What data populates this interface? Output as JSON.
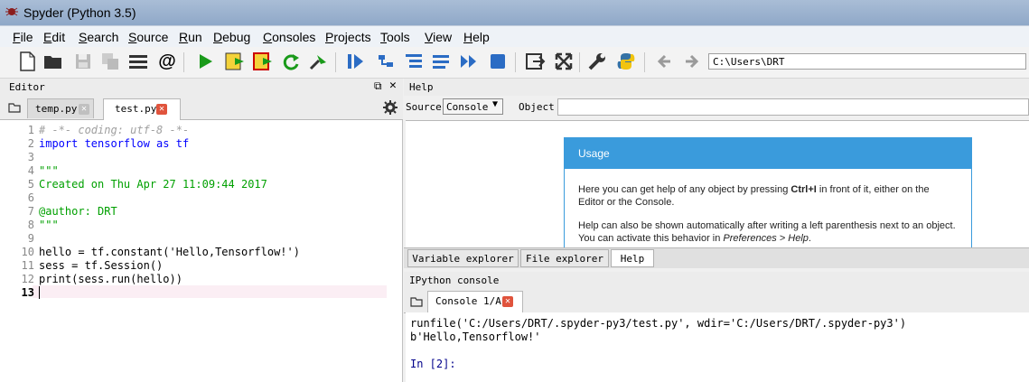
{
  "window": {
    "title": "Spyder (Python 3.5)"
  },
  "menu": [
    {
      "u": "F",
      "rest": "ile"
    },
    {
      "u": "E",
      "rest": "dit"
    },
    {
      "u": "S",
      "rest": "earch"
    },
    {
      "u": "S",
      "rest": "ource"
    },
    {
      "u": "R",
      "rest": "un"
    },
    {
      "u": "D",
      "rest": "ebug"
    },
    {
      "u": "C",
      "rest": "onsoles"
    },
    {
      "u": "P",
      "rest": "rojects"
    },
    {
      "u": "T",
      "rest": "ools"
    },
    {
      "u": "V",
      "rest": "iew"
    },
    {
      "u": "H",
      "rest": "elp"
    }
  ],
  "toolbar": {
    "path": "C:\\Users\\DRT"
  },
  "editor": {
    "title": "Editor",
    "tabs": [
      {
        "label": "temp.py"
      },
      {
        "label": "test.py"
      }
    ],
    "lines": [
      {
        "n": "1",
        "t": "# -*- coding: utf-8 -*-"
      },
      {
        "n": "2",
        "t": "import tensorflow as tf"
      },
      {
        "n": "3",
        "t": ""
      },
      {
        "n": "4",
        "t": "\"\"\""
      },
      {
        "n": "5",
        "t": "Created on Thu Apr 27 11:09:44 2017"
      },
      {
        "n": "6",
        "t": ""
      },
      {
        "n": "7",
        "t": "@author: DRT"
      },
      {
        "n": "8",
        "t": "\"\"\""
      },
      {
        "n": "9",
        "t": ""
      },
      {
        "n": "10",
        "t": "hello = tf.constant('Hello,Tensorflow!')"
      },
      {
        "n": "11",
        "t": "sess = tf.Session()"
      },
      {
        "n": "12",
        "t": "print(sess.run(hello))"
      },
      {
        "n": "13",
        "t": ""
      }
    ]
  },
  "help": {
    "title": "Help",
    "source_label": "Source",
    "source_value": "Console",
    "object_label": "Object",
    "usage": {
      "heading": "Usage",
      "p1_a": "Here you can get help of any object by pressing ",
      "p1_key": "Ctrl+I",
      "p1_b": " in front of it, either on the Editor or the Console.",
      "p2_a": "Help can also be shown automatically after writing a left parenthesis next to an object. You can activate this behavior in ",
      "p2_em": "Preferences > Help",
      "p2_b": "."
    }
  },
  "pane_tabs": [
    {
      "label": "Variable explorer"
    },
    {
      "label": "File explorer"
    },
    {
      "label": "Help"
    }
  ],
  "ipython": {
    "title": "IPython console",
    "tab": "Console 1/A",
    "lines": [
      "runfile('C:/Users/DRT/.spyder-py3/test.py', wdir='C:/Users/DRT/.spyder-py3')",
      "b'Hello,Tensorflow!'",
      "",
      "In [2]:"
    ]
  },
  "colors": {
    "accent": "#3a9bdc",
    "close": "#e0533c",
    "comment": "#a0a0a0",
    "string": "#00a000",
    "keyword": "#0000ff",
    "current_line": "#fbeef4"
  }
}
